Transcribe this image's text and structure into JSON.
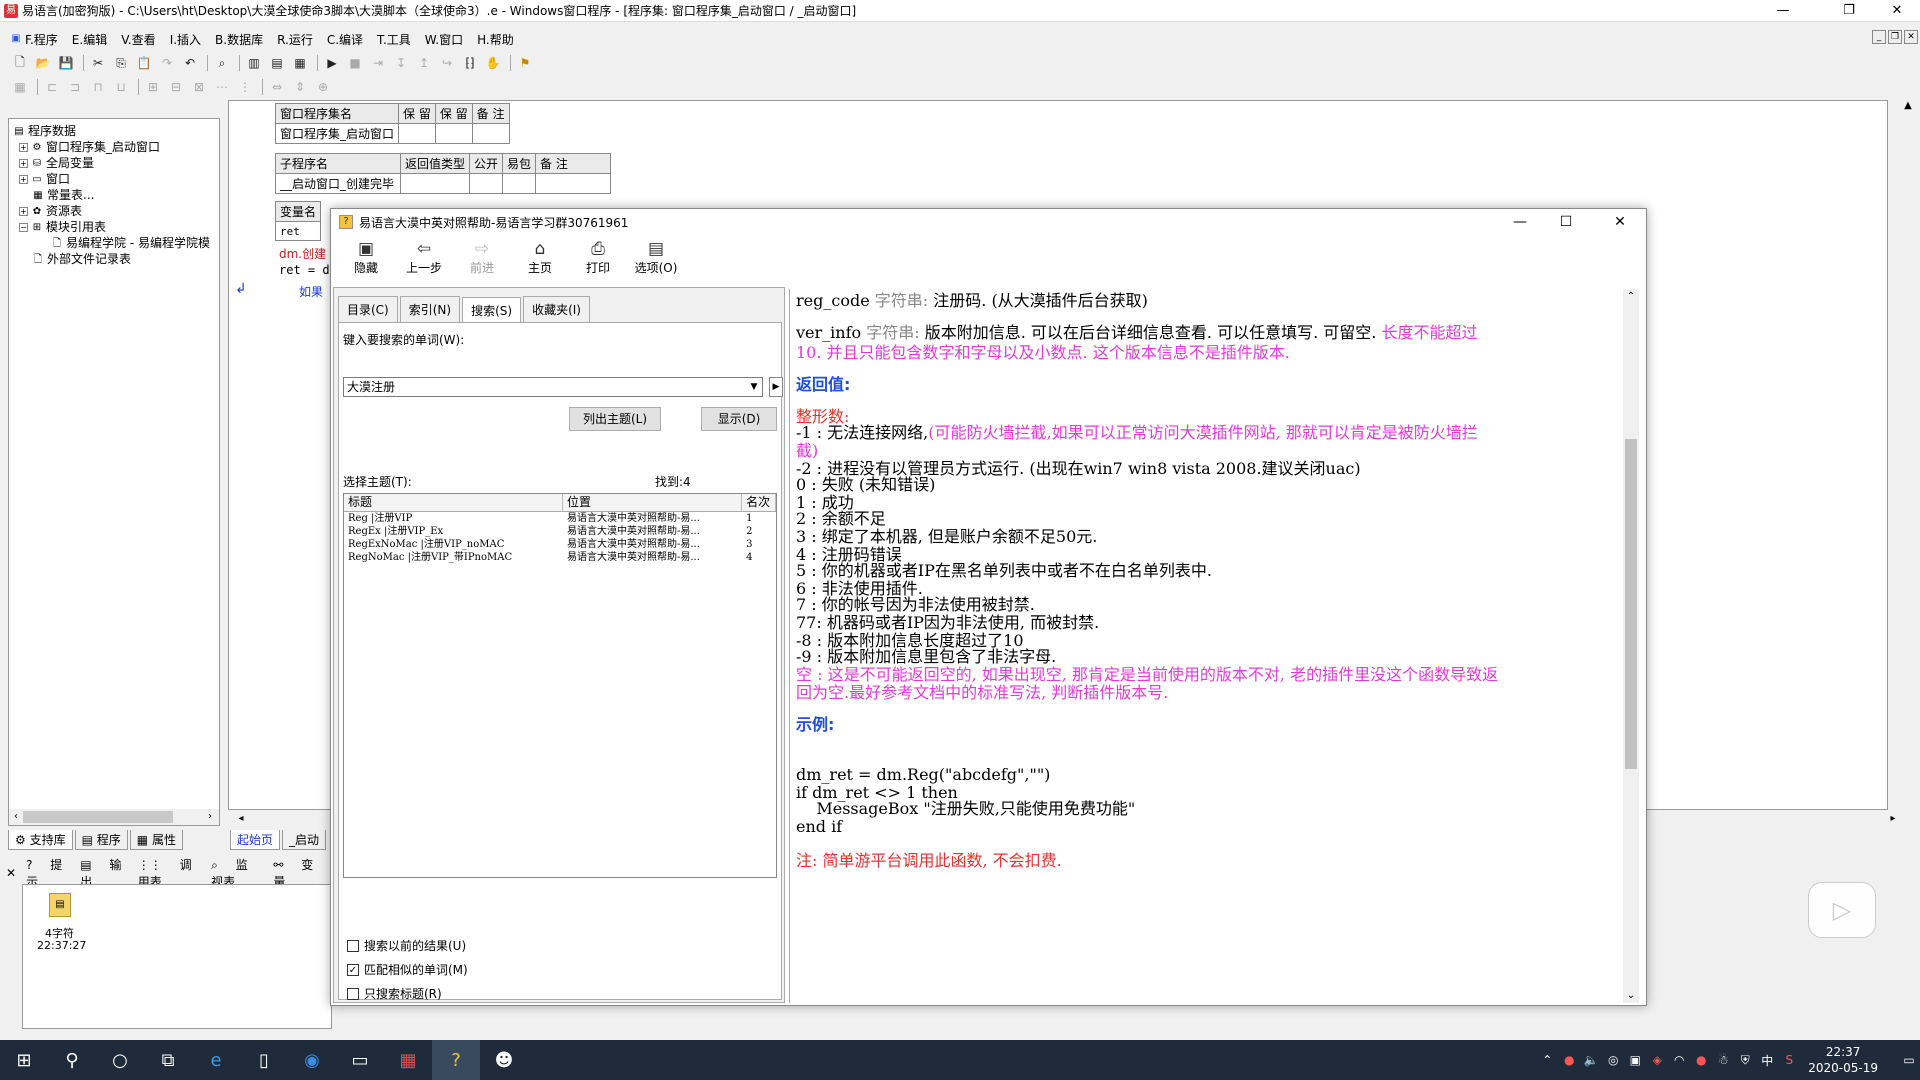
{
  "window": {
    "title": "易语言(加密狗版) - C:\\Users\\ht\\Desktop\\大漠全球使命3脚本\\大漠脚本（全球使命3）.e - Windows窗口程序 - [程序集: 窗口程序集_启动窗口 / _启动窗口]"
  },
  "menu": [
    "F.程序",
    "E.编辑",
    "V.查看",
    "I.插入",
    "B.数据库",
    "R.运行",
    "C.编译",
    "T.工具",
    "W.窗口",
    "H.帮助"
  ],
  "tree": {
    "root": "程序数据",
    "items": [
      "窗口程序集_启动窗口",
      "全局变量",
      "窗口",
      "常量表...",
      "资源表",
      "模块引用表",
      "易编程学院 - 易编程学院模",
      "外部文件记录表"
    ]
  },
  "panel_tabs": [
    "支持库",
    "程序",
    "属性"
  ],
  "editor_tabs": [
    "起始页",
    "_启动"
  ],
  "code_tables": {
    "assembly": {
      "headers": [
        "窗口程序集名",
        "保 留",
        "保 留",
        "备 注"
      ],
      "row": [
        "窗口程序集_启动窗口",
        "",
        "",
        ""
      ]
    },
    "sub": {
      "headers": [
        "子程序名",
        "返回值类型",
        "公开",
        "易包",
        "备 注"
      ],
      "row": [
        "__启动窗口_创建完毕",
        "",
        "",
        "",
        ""
      ]
    },
    "var": {
      "headers": [
        "变量名"
      ],
      "row": [
        "ret"
      ]
    },
    "lines": [
      "dm.创建",
      "ret = dm",
      "如果"
    ]
  },
  "bottom_tabs": [
    "提示",
    "输出",
    "调用表",
    "监视表",
    "变量"
  ],
  "output": {
    "label": "4字符",
    "time": "22:37:27"
  },
  "help": {
    "title": "易语言大漠中英对照帮助-易语言学习群30761961",
    "toolbar": [
      "隐藏",
      "上一步",
      "前进",
      "主页",
      "打印",
      "选项(O)"
    ],
    "tabs": [
      "目录(C)",
      "索引(N)",
      "搜索(S)",
      "收藏夹(I)"
    ],
    "search_label": "键入要搜索的单词(W):",
    "search_value": "大漠注册",
    "list_topics_btn": "列出主题(L)",
    "display_btn": "显示(D)",
    "select_label": "选择主题(T):",
    "found": "找到:4",
    "columns": [
      "标题",
      "位置",
      "名次"
    ],
    "results": [
      {
        "title": "Reg     |注册VIP",
        "loc": "易语言大漠中英对照帮助-易...",
        "rank": "1"
      },
      {
        "title": "RegEx      |注册VIP_Ex",
        "loc": "易语言大漠中英对照帮助-易...",
        "rank": "2"
      },
      {
        "title": "RegExNoMac      |注册VIP_noMAC",
        "loc": "易语言大漠中英对照帮助-易...",
        "rank": "3"
      },
      {
        "title": "RegNoMac      |注册VIP_带IPnoMAC",
        "loc": "易语言大漠中英对照帮助-易...",
        "rank": "4"
      }
    ],
    "checks": [
      {
        "label": "搜索以前的结果(U)",
        "checked": ""
      },
      {
        "label": "匹配相似的单词(M)",
        "checked": "✓"
      },
      {
        "label": "只搜索标题(R)",
        "checked": ""
      }
    ],
    "content": {
      "reg_code_name": "reg_code",
      "reg_code_type": "字符串:",
      "reg_code_desc": "注册码. (从大漠插件后台获取)",
      "ver_info_name": "ver_info",
      "ver_info_type": "字符串:",
      "ver_info_desc": "版本附加信息. 可以在后台详细信息查看. 可以任意填写. 可留空.",
      "ver_info_warn1": "长度不能超过",
      "ver_info_warn2": "10. 并且只能包含数字和字母以及小数点. 这个版本信息不是插件版本.",
      "return_heading": "返回值:",
      "int_label": "整形数:",
      "r_m1a": "-1 :  无法连接网络,",
      "r_m1b": "(可能防火墙拦截,如果可以正常访问大漠插件网站, 那就可以肯定是被防火墙拦",
      "r_m1c": "截)",
      "r_m2": "-2 :  进程没有以管理员方式运行. (出现在win7 win8 vista 2008.建议关闭uac)",
      "r_0": "0  :  失败 (未知错误)",
      "r_1": "1  :  成功",
      "r_2": "2  :  余额不足",
      "r_3": "3  :  绑定了本机器, 但是账户余额不足50元.",
      "r_4": "4  :  注册码错误",
      "r_5": "5  :  你的机器或者IP在黑名单列表中或者不在白名单列表中.",
      "r_6": "6  :  非法使用插件.",
      "r_7": "7  :  你的帐号因为非法使用被封禁.",
      "r_77": "77:   机器码或者IP因为非法使用, 而被封禁.",
      "r_m8": "-8 :  版本附加信息长度超过了10",
      "r_m9": "-9 :  版本附加信息里包含了非法字母.",
      "r_empty1": "空 :  这是不可能返回空的, 如果出现空, 那肯定是当前使用的版本不对, 老的插件里没这个函数导致返",
      "r_empty2": "回为空.最好参考文档中的标准写法, 判断插件版本号.",
      "example_heading": "示例:",
      "code1": "dm_ret = dm.Reg(\"abcdefg\",\"\")",
      "code2": "if dm_ret <> 1 then",
      "code3": "    MessageBox \"注册失败,只能使用免费功能\"",
      "code4": "end if",
      "note": "注: 简单游平台调用此函数, 不会扣费."
    }
  },
  "taskbar": {
    "time": "22:37",
    "date": "2020-05-19",
    "ime": "中"
  },
  "colors": {
    "heading_blue": "#1e4fd8",
    "pink": "#e03bd6",
    "red": "#e03333",
    "taskbar": "#1f2b3a"
  }
}
